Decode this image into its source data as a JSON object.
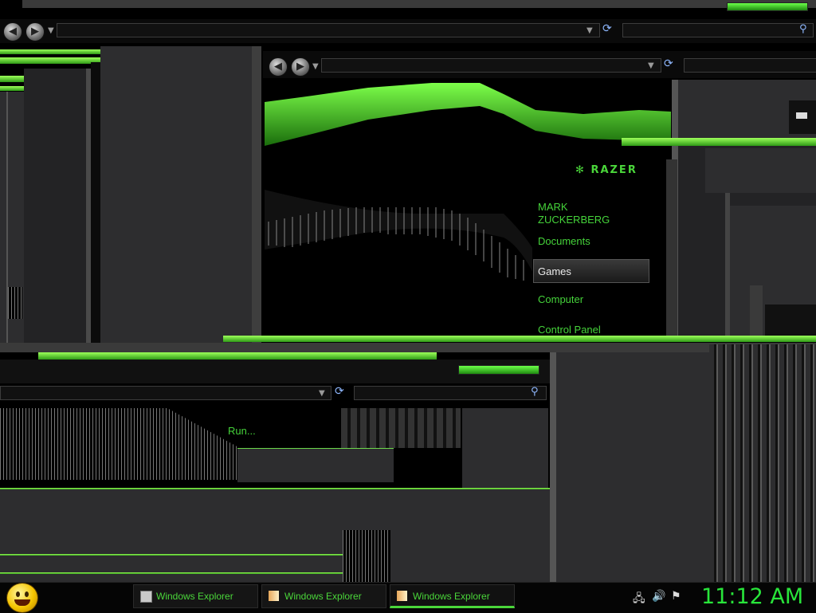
{
  "start_menu": {
    "logo_text": "RAZER",
    "items": [
      {
        "label": "MARK"
      },
      {
        "label": "ZUCKERBERG"
      },
      {
        "label": "Documents"
      },
      {
        "label": "Games"
      },
      {
        "label": "Computer"
      },
      {
        "label": "Control Panel"
      },
      {
        "label": "Run..."
      }
    ]
  },
  "taskbar": {
    "buttons": [
      {
        "label": "Windows Explorer"
      },
      {
        "label": "Windows Explorer"
      },
      {
        "label": "Windows Explorer"
      }
    ],
    "clock": "11:12 AM"
  },
  "icons": {
    "back": "back-arrow-icon",
    "forward": "forward-arrow-icon",
    "refresh": "refresh-icon",
    "search": "search-icon",
    "start": "smiley-start-orb-icon"
  },
  "colors": {
    "accent": "#4ad63a",
    "panel": "#2d2d2f",
    "background": "#000000",
    "highlight": "#f2e600"
  }
}
